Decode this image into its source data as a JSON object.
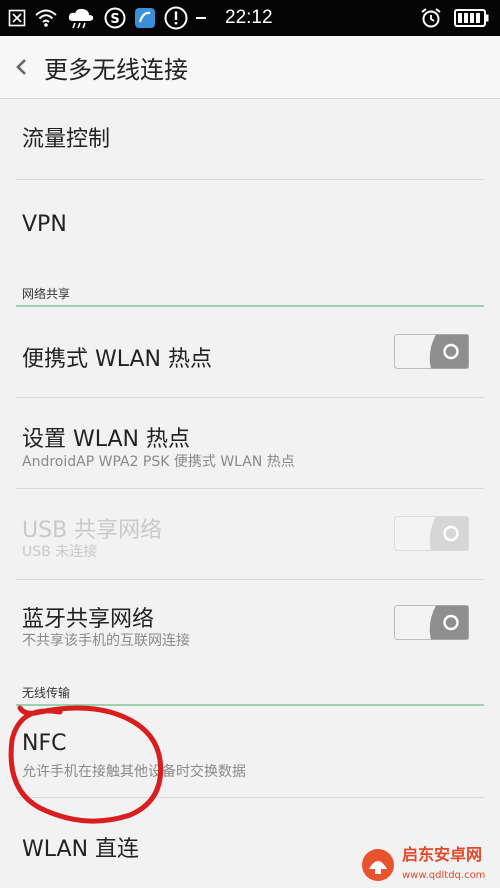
{
  "status_bar": {
    "time": "22:12",
    "icons": [
      "notification-x-icon",
      "wifi-icon",
      "cloud-rain-icon",
      "sogou-s-icon",
      "app-icon",
      "alert-icon",
      "more-dots-icon",
      "alarm-icon",
      "battery-icon"
    ]
  },
  "header": {
    "title": "更多无线连接"
  },
  "rows": {
    "traffic": {
      "title": "流量控制"
    },
    "vpn": {
      "title": "VPN"
    },
    "hotspot": {
      "title": "便携式 WLAN 热点",
      "toggle": "off"
    },
    "hotspot_settings": {
      "title": "设置 WLAN 热点",
      "subtitle": "AndroidAP WPA2 PSK 便携式 WLAN 热点"
    },
    "usb_tether": {
      "title": "USB 共享网络",
      "subtitle": "USB 未连接",
      "toggle": "off",
      "disabled": true
    },
    "bt_tether": {
      "title": "蓝牙共享网络",
      "subtitle": "不共享该手机的互联网连接",
      "toggle": "off"
    },
    "nfc": {
      "title": "NFC",
      "subtitle": "允许手机在接触其他设备时交换数据"
    },
    "wlan_direct": {
      "title": "WLAN 直连"
    }
  },
  "sections": {
    "network_share": "网络共享",
    "wireless_transfer": "无线传输"
  },
  "colors": {
    "statusbar": "#050505",
    "accent_line": "#9bd0b2",
    "annotation": "#d81e1e",
    "toggle_knob": "#8f8f8f"
  }
}
